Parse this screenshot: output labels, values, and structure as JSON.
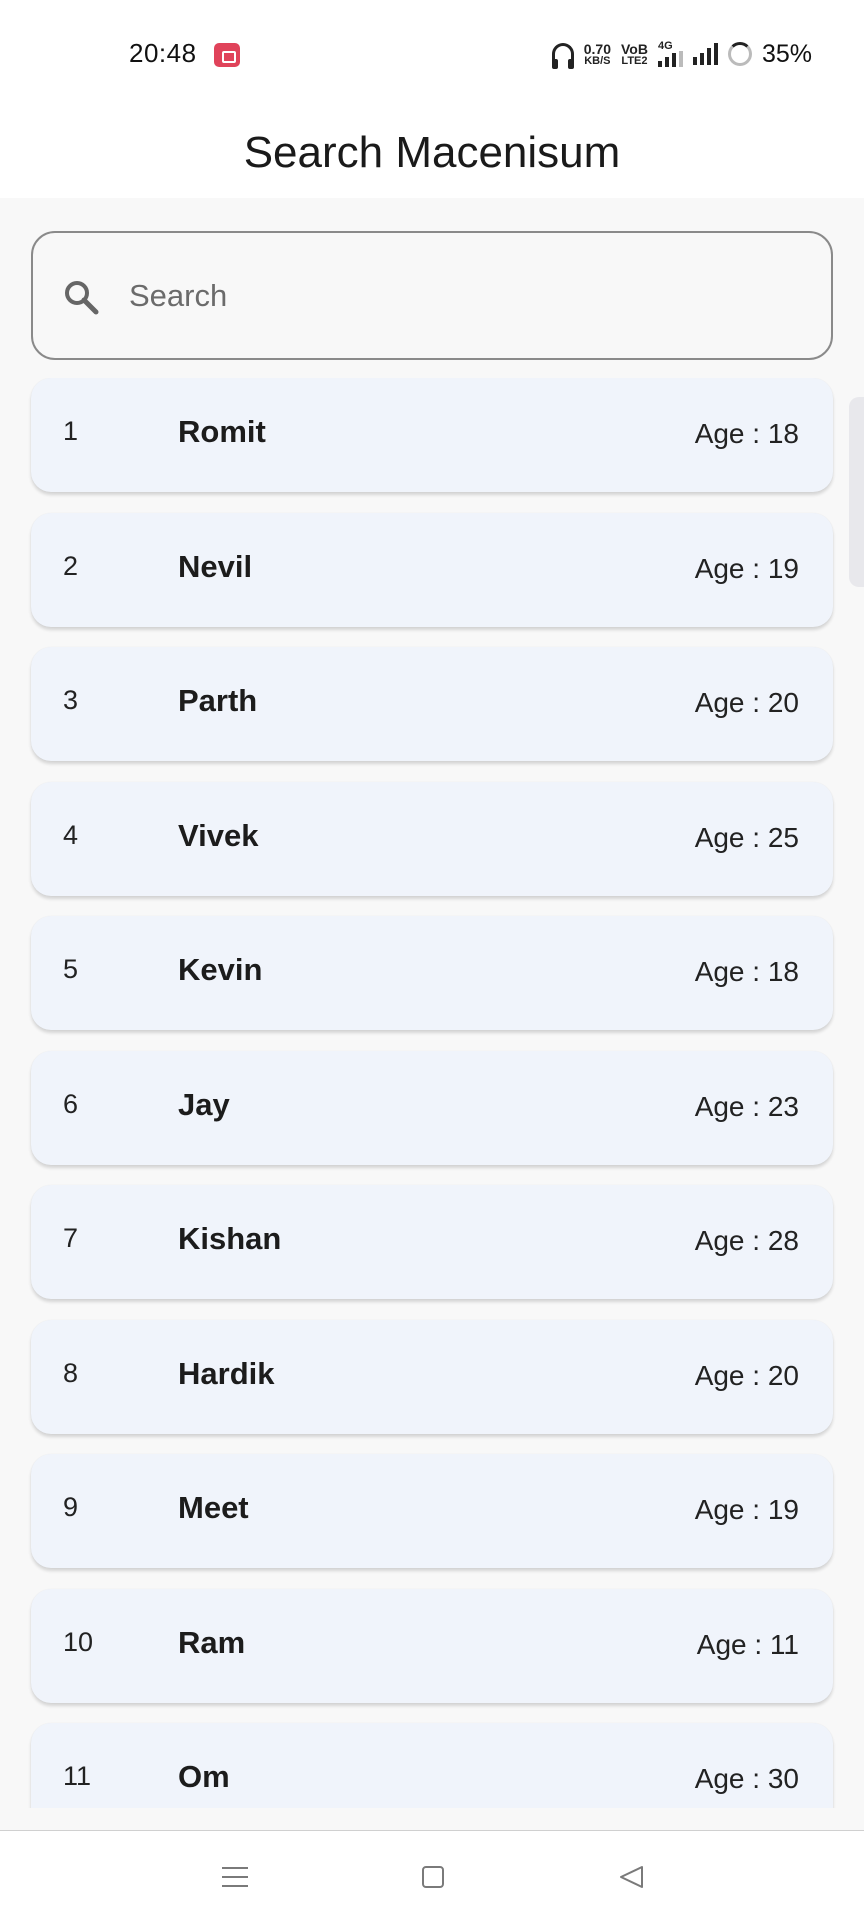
{
  "status_bar": {
    "time": "20:48",
    "net_speed": "0.70",
    "net_unit": "KB/S",
    "volte_top": "VoB",
    "volte_bottom": "LTE2",
    "network": "4G",
    "battery": "35%"
  },
  "app_bar": {
    "title": "Search Macenisum"
  },
  "search": {
    "placeholder": "Search",
    "value": ""
  },
  "list": {
    "items": [
      {
        "index": "1",
        "name": "Romit",
        "age": "Age : 18"
      },
      {
        "index": "2",
        "name": "Nevil",
        "age": "Age : 19"
      },
      {
        "index": "3",
        "name": "Parth",
        "age": "Age : 20"
      },
      {
        "index": "4",
        "name": "Vivek",
        "age": "Age : 25"
      },
      {
        "index": "5",
        "name": "Kevin",
        "age": "Age : 18"
      },
      {
        "index": "6",
        "name": "Jay",
        "age": "Age : 23"
      },
      {
        "index": "7",
        "name": "Kishan",
        "age": "Age : 28"
      },
      {
        "index": "8",
        "name": "Hardik",
        "age": "Age : 20"
      },
      {
        "index": "9",
        "name": "Meet",
        "age": "Age : 19"
      },
      {
        "index": "10",
        "name": "Ram",
        "age": "Age : 11"
      },
      {
        "index": "11",
        "name": "Om",
        "age": "Age : 30"
      }
    ]
  },
  "nav": {
    "icons": [
      "menu-icon",
      "home-icon",
      "back-icon"
    ]
  }
}
